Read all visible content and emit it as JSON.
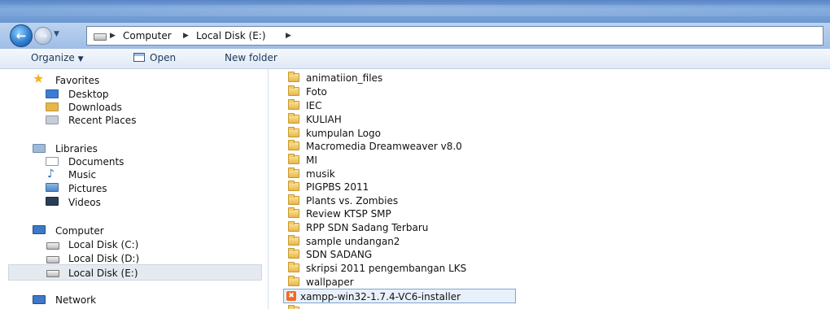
{
  "address": {
    "crumbs": [
      "Computer",
      "Local Disk (E:)"
    ]
  },
  "toolbar": {
    "organize": "Organize",
    "open": "Open",
    "new_folder": "New folder"
  },
  "nav": {
    "favorites": {
      "label": "Favorites",
      "items": [
        "Desktop",
        "Downloads",
        "Recent Places"
      ]
    },
    "libraries": {
      "label": "Libraries",
      "items": [
        "Documents",
        "Music",
        "Pictures",
        "Videos"
      ]
    },
    "computer": {
      "label": "Computer",
      "items": [
        "Local Disk (C:)",
        "Local Disk (D:)",
        "Local Disk (E:)"
      ]
    },
    "network": {
      "label": "Network"
    }
  },
  "files": [
    "animatiion_files",
    "Foto",
    "IEC",
    "KULIAH",
    "kumpulan Logo",
    "Macromedia Dreamweaver v8.0",
    "MI",
    "musik",
    "PIGPBS 2011",
    "Plants vs. Zombies",
    "Review KTSP SMP",
    "RPP SDN Sadang Terbaru",
    "sample undangan2",
    "SDN SADANG",
    "skripsi 2011 pengembangan LKS",
    "wallpaper"
  ],
  "selected_file": "xampp-win32-1.7.4-VC6-installer",
  "colors": {
    "folder": "#e6b84a",
    "selection": "#e8f1fb",
    "xampp": "#f36b22"
  }
}
